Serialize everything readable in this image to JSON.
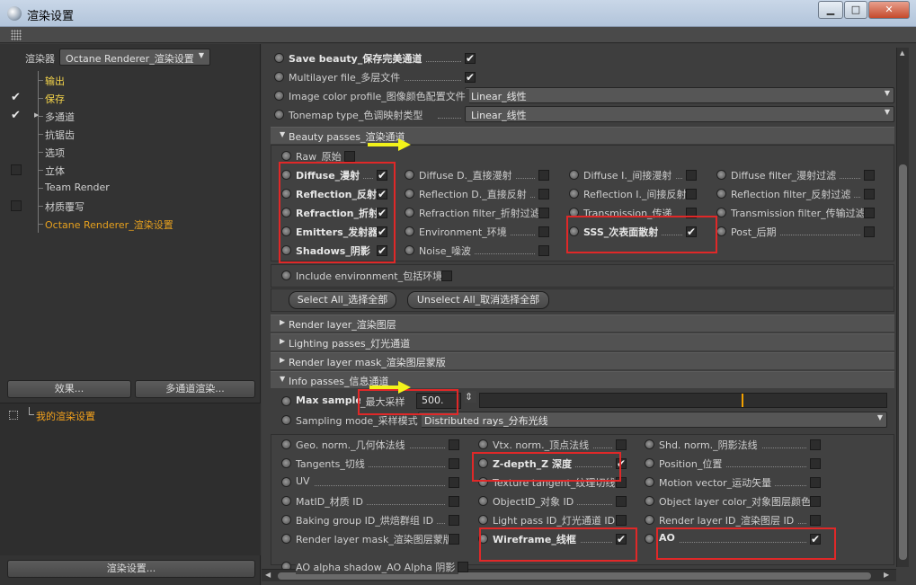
{
  "window": {
    "title": "渲染设置",
    "minimize": "▁",
    "maximize": "□",
    "close": "✕"
  },
  "left": {
    "renderer_label": "渲染器",
    "renderer_value": "Octane Renderer_渲染设置",
    "tree": [
      {
        "label": "输出",
        "checked": false,
        "has_box": false,
        "style": "hl"
      },
      {
        "label": "保存",
        "checked": true,
        "has_box": false,
        "style": "hl"
      },
      {
        "label": "多通道",
        "checked": true,
        "has_box": false,
        "style": "normal",
        "expandable": true
      },
      {
        "label": "抗锯齿",
        "checked": false,
        "has_box": false,
        "style": "normal"
      },
      {
        "label": "选项",
        "checked": false,
        "has_box": false,
        "style": "normal"
      },
      {
        "label": "立体",
        "checked": false,
        "has_box": true,
        "style": "normal"
      },
      {
        "label": "Team Render",
        "checked": false,
        "has_box": false,
        "style": "normal"
      },
      {
        "label": "材质覆写",
        "checked": false,
        "has_box": true,
        "style": "normal"
      },
      {
        "label": "Octane Renderer_渲染设置",
        "checked": false,
        "has_box": false,
        "style": "active"
      }
    ],
    "effects_button": "效果...",
    "multipass_button": "多通道渲染...",
    "setting_item": "我的渲染设置",
    "render_settings_button": "渲染设置..."
  },
  "right": {
    "top_rows": [
      {
        "label": "Save beauty_保存完美通道",
        "bold": true,
        "checked": true
      },
      {
        "label": "Multilayer file_多层文件",
        "bold": false,
        "checked": true
      }
    ],
    "image_color_profile": {
      "label": "Image color profile_图像颜色配置文件",
      "value": "Linear_线性"
    },
    "tonemap_type": {
      "label": "Tonemap type_色调映射类型",
      "value": "Linear_线性"
    },
    "beauty_section": "Beauty passes_渲染通道",
    "raw": {
      "label": "Raw_原始",
      "checked": false
    },
    "beauty_columns": [
      [
        {
          "label": "Diffuse_漫射",
          "bold": true,
          "checked": true
        },
        {
          "label": "Reflection_反射",
          "bold": true,
          "checked": true
        },
        {
          "label": "Refraction_折射",
          "bold": true,
          "checked": true
        },
        {
          "label": "Emitters_发射器",
          "bold": true,
          "checked": true
        },
        {
          "label": "Shadows_阴影",
          "bold": true,
          "checked": true
        }
      ],
      [
        {
          "label": "Diffuse D._直接漫射",
          "bold": false,
          "checked": false
        },
        {
          "label": "Reflection D._直接反射",
          "bold": false,
          "checked": false
        },
        {
          "label": "Refraction filter_折射过滤",
          "bold": false,
          "checked": false
        },
        {
          "label": "Environment_环境",
          "bold": false,
          "checked": false
        },
        {
          "label": "Noise_噪波",
          "bold": false,
          "checked": false
        }
      ],
      [
        {
          "label": "Diffuse I._间接漫射",
          "bold": false,
          "checked": false
        },
        {
          "label": "Reflection I._间接反射",
          "bold": false,
          "checked": false
        },
        {
          "label": "Transmission_传递",
          "bold": false,
          "checked": false
        },
        {
          "label": "SSS_次表面散射",
          "bold": true,
          "checked": true
        }
      ],
      [
        {
          "label": "Diffuse filter_漫射过滤",
          "bold": false,
          "checked": false
        },
        {
          "label": "Reflection filter_反射过滤",
          "bold": false,
          "checked": false
        },
        {
          "label": "Transmission filter_传输过滤",
          "bold": false,
          "checked": false
        },
        {
          "label": "Post_后期",
          "bold": false,
          "checked": false
        }
      ]
    ],
    "include_environment": {
      "label": "Include environment_包括环境",
      "checked": false
    },
    "select_all_button": "Select All_选择全部",
    "unselect_all_button": "Unselect All_取消选择全部",
    "collapsed_sections": [
      "Render layer_渲染图层",
      "Lighting passes_灯光通道",
      "Render layer mask_渲染图层蒙版"
    ],
    "info_section": "Info passes_信息通道",
    "max_samples": {
      "label_bold": "Max samples",
      "label_rest": "_最大采样",
      "value": "500.",
      "slider_fraction": 0.64
    },
    "sampling_mode": {
      "label": "Sampling mode_采样模式",
      "value": "Distributed rays_分布光线"
    },
    "info_columns": [
      [
        {
          "label": "Geo. norm._几何体法线",
          "bold": false,
          "checked": false
        },
        {
          "label": "Tangents_切线",
          "bold": false,
          "checked": false
        },
        {
          "label": "UV",
          "bold": false,
          "checked": false
        },
        {
          "label": "MatID_材质 ID",
          "bold": false,
          "checked": false
        },
        {
          "label": "Baking group ID_烘焙群组 ID",
          "bold": false,
          "checked": false
        },
        {
          "label": "Render layer mask_渲染图层蒙版",
          "bold": false,
          "checked": false
        }
      ],
      [
        {
          "label": "Vtx. norm._顶点法线",
          "bold": false,
          "checked": false
        },
        {
          "label": "Z-depth_Z 深度",
          "bold": true,
          "checked": true
        },
        {
          "label": "Texture tangent_纹理切线",
          "bold": false,
          "checked": false
        },
        {
          "label": "ObjectID_对象 ID",
          "bold": false,
          "checked": false
        },
        {
          "label": "Light pass ID_灯光通道 ID",
          "bold": false,
          "checked": false
        },
        {
          "label": "Wireframe_线框",
          "bold": true,
          "checked": true
        }
      ],
      [
        {
          "label": "Shd. norm._阴影法线",
          "bold": false,
          "checked": false
        },
        {
          "label": "Position_位置",
          "bold": false,
          "checked": false
        },
        {
          "label": "Motion vector_运动矢量",
          "bold": false,
          "checked": false
        },
        {
          "label": "Object layer color_对象图层颜色",
          "bold": false,
          "checked": false
        },
        {
          "label": "Render layer ID_渲染图层 ID",
          "bold": false,
          "checked": false
        },
        {
          "label": "AO",
          "bold": true,
          "checked": true
        }
      ]
    ],
    "last_row": "AO alpha shadow_AO Alpha 阴影"
  },
  "colors": {
    "highlight_box": "#e02828",
    "arrow": "#f2f21a",
    "active_item": "#e6a01e",
    "selected_item": "#f4d44a"
  }
}
